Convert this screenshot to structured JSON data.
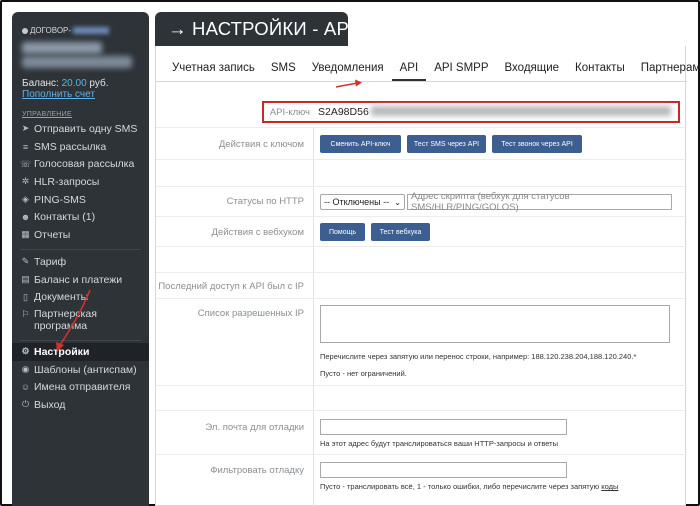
{
  "sidebar": {
    "contract_label": "ДОГОВОР-",
    "balance_label": "Баланс:",
    "balance_amount": "20.00",
    "balance_currency": "руб.",
    "topup_link": "Пополнить счет",
    "section_label": "УПРАВЛЕНИЕ",
    "items_top": [
      {
        "icon": "send-icon",
        "glyph": "➤",
        "label": "Отправить одну SMS"
      },
      {
        "icon": "list-icon",
        "glyph": "≡",
        "label": "SMS рассылка"
      },
      {
        "icon": "phone-icon",
        "glyph": "☏",
        "label": "Голосовая рассылка"
      },
      {
        "icon": "network-icon",
        "glyph": "✲",
        "label": "HLR-запросы"
      },
      {
        "icon": "ping-icon",
        "glyph": "◈",
        "label": "PING-SMS"
      },
      {
        "icon": "contacts-icon",
        "glyph": "☻",
        "label": "Контакты (1)"
      },
      {
        "icon": "reports-icon",
        "glyph": "▦",
        "label": "Отчеты"
      }
    ],
    "items_bottom": [
      {
        "icon": "tariff-icon",
        "glyph": "✎",
        "label": "Тариф"
      },
      {
        "icon": "wallet-icon",
        "glyph": "▤",
        "label": "Баланс и платежи"
      },
      {
        "icon": "document-icon",
        "glyph": "▯",
        "label": "Документы"
      },
      {
        "icon": "partner-icon",
        "glyph": "⚐",
        "label": "Партнерская программа"
      }
    ],
    "items_settings": [
      {
        "icon": "gear-icon",
        "glyph": "⚙",
        "label": "Настройки",
        "active": true
      },
      {
        "icon": "template-icon",
        "glyph": "◉",
        "label": "Шаблоны (антиспам)"
      },
      {
        "icon": "sender-icon",
        "glyph": "☺",
        "label": "Имена отправителя"
      },
      {
        "icon": "power-icon",
        "glyph": "⏻",
        "label": "Выход"
      }
    ]
  },
  "header": {
    "title": "→ НАСТРОЙКИ - API"
  },
  "tabs": [
    {
      "label": "Учетная запись",
      "active": false
    },
    {
      "label": "SMS",
      "active": false
    },
    {
      "label": "Уведомления",
      "active": false
    },
    {
      "label": "API",
      "active": true
    },
    {
      "label": "API SMPP",
      "active": false
    },
    {
      "label": "Входящие",
      "active": false
    },
    {
      "label": "Контакты",
      "active": false
    },
    {
      "label": "Партнерам",
      "active": false
    }
  ],
  "form": {
    "api_key_label": "API-ключ",
    "api_key_value": "S2A98D56",
    "key_actions_label": "Действия с ключом",
    "btn_change_key": "Сменить API-ключ",
    "btn_test_sms": "Тест SMS через API",
    "btn_test_call": "Тест звонок через API",
    "http_status_label": "Статусы по HTTP",
    "http_status_select": "-- Отключены --",
    "script_placeholder": "Адрес скрипта (вебхук для статусов SMS/HLR/PING/GOLOS)",
    "webhook_actions_label": "Действия с вебхуком",
    "btn_help": "Помощь",
    "btn_test_webhook": "Тест вебхука",
    "last_access_label": "Последний доступ к API был с IP",
    "allowed_ip_label": "Список разрешенных IP",
    "allowed_ip_hint": "Перечислите через запятую или перенос строки, например: 188.120.238.204,188.120.240.*",
    "allowed_ip_empty_hint": "Пусто - нет ограничений.",
    "debug_email_label": "Эл. почта для отладки",
    "debug_email_hint": "На этот адрес будут транслироваться ваши HTTP-запросы и ответы",
    "filter_debug_label": "Фильтровать отладку",
    "filter_debug_hint": "Пусто - транслировать всё, 1 - только ошибки, либо перечислите через запятую",
    "filter_debug_link": "коды"
  },
  "colors": {
    "sidebar_bg": "#2e3338",
    "accent_blue": "#5fb3e8",
    "button_blue": "#3c5e91",
    "highlight_red": "#c62828"
  }
}
